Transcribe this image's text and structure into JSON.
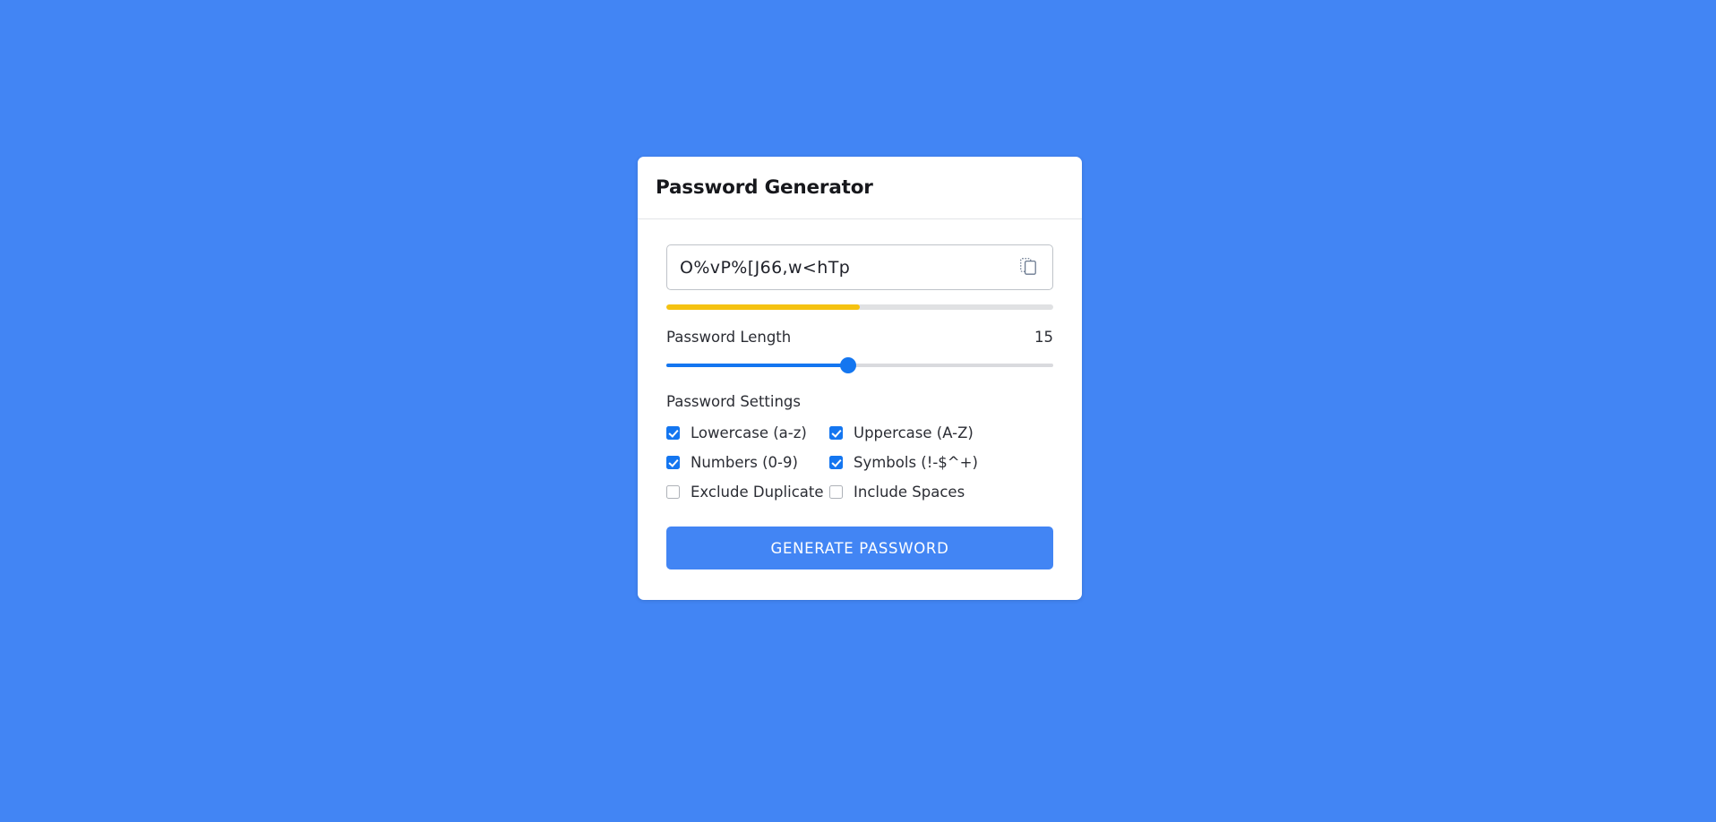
{
  "theme": {
    "page_background": "#4285f4",
    "card_background": "#ffffff",
    "accent": "#1476f0",
    "button": "#4285f4",
    "strength_color": "#f5c211"
  },
  "card": {
    "title": "Password Generator"
  },
  "password_output": {
    "value": "O%vP%[J66,w<hTp",
    "copy_icon": "copy-icon",
    "copy_label": "Copy"
  },
  "strength": {
    "percent": 50,
    "color": "#f5c211"
  },
  "length": {
    "label": "Password Length",
    "value": "15",
    "slider_percent": 47
  },
  "settings": {
    "title": "Password Settings",
    "options": [
      {
        "label": "Lowercase (a-z)",
        "checked": true
      },
      {
        "label": "Uppercase (A-Z)",
        "checked": true
      },
      {
        "label": "Numbers (0-9)",
        "checked": true
      },
      {
        "label": "Symbols (!-$^+)",
        "checked": true
      },
      {
        "label": "Exclude Duplicate",
        "checked": false
      },
      {
        "label": "Include Spaces",
        "checked": false
      }
    ]
  },
  "generate_button": {
    "label": "GENERATE PASSWORD"
  }
}
